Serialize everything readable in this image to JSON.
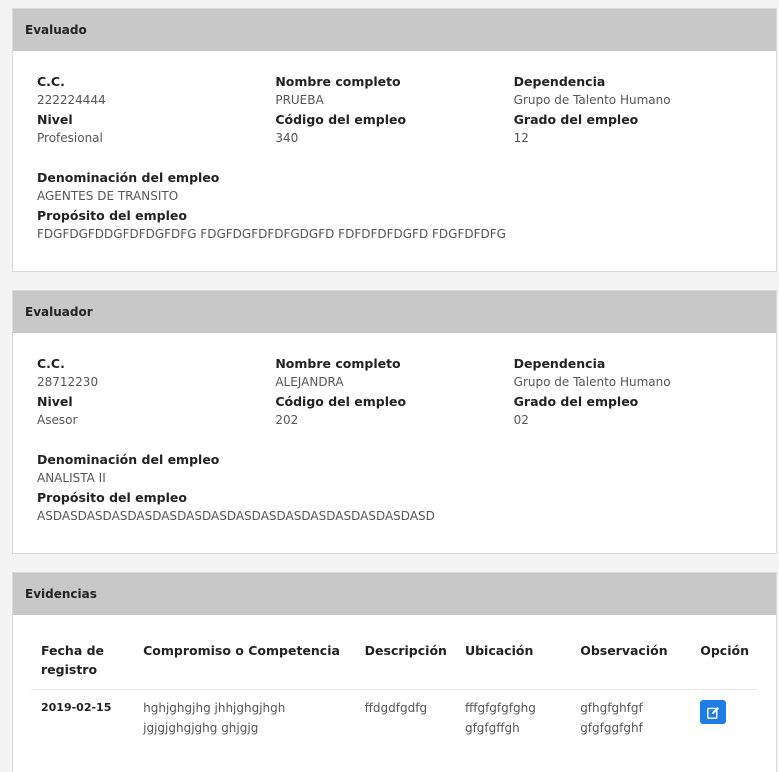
{
  "evaluado": {
    "header": "Evaluado",
    "cc_label": "C.C.",
    "cc": "222224444",
    "nombre_label": "Nombre completo",
    "nombre": "PRUEBA",
    "dependencia_label": "Dependencia",
    "dependencia": "Grupo de Talento Humano",
    "nivel_label": "Nivel",
    "nivel": "Profesional",
    "codigo_label": "Código del empleo",
    "codigo": "340",
    "grado_label": "Grado del empleo",
    "grado": "12",
    "denominacion_label": "Denominación del empleo",
    "denominacion": "AGENTES DE TRANSITO",
    "proposito_label": "Propósito del empleo",
    "proposito": "FDGFDGFDDGFDFDGFDFG FDGFDGFDFDFGDGFD FDFDFDFDGFD FDGFDFDFG"
  },
  "evaluador": {
    "header": "Evaluador",
    "cc_label": "C.C.",
    "cc": "28712230",
    "nombre_label": "Nombre completo",
    "nombre": "ALEJANDRA",
    "dependencia_label": "Dependencia",
    "dependencia": "Grupo de Talento Humano",
    "nivel_label": "Nivel",
    "nivel": "Asesor",
    "codigo_label": "Código del empleo",
    "codigo": "202",
    "grado_label": "Grado del empleo",
    "grado": "02",
    "denominacion_label": "Denominación del empleo",
    "denominacion": "ANALISTA II",
    "proposito_label": "Propósito del empleo",
    "proposito": "ASDASDASDASDASDASDASDASDASDASDASDASDASDASDASDASD"
  },
  "evidencias": {
    "header": "Evidencias",
    "columns": {
      "fecha": "Fecha de registro",
      "compromiso": "Compromiso o Competencia",
      "descripcion": "Descripción",
      "ubicacion": "Ubicación",
      "observacion": "Observación",
      "opcion": "Opción"
    },
    "rows": [
      {
        "fecha": "2019-02-15",
        "compromiso": "hghjghgjhg jhhjghgjhgh jgjgjghgjghg ghjgjg",
        "descripcion": "ffdgdfgdfg",
        "ubicacion": "fffgfgfgfghg gfgfgffgh",
        "observacion": "gfhgfghfgf gfgfggfghf",
        "accion_icon": "edit-icon"
      }
    ]
  },
  "colors": {
    "header_bg": "#c8c8c8",
    "accent": "#1e7ee4"
  }
}
